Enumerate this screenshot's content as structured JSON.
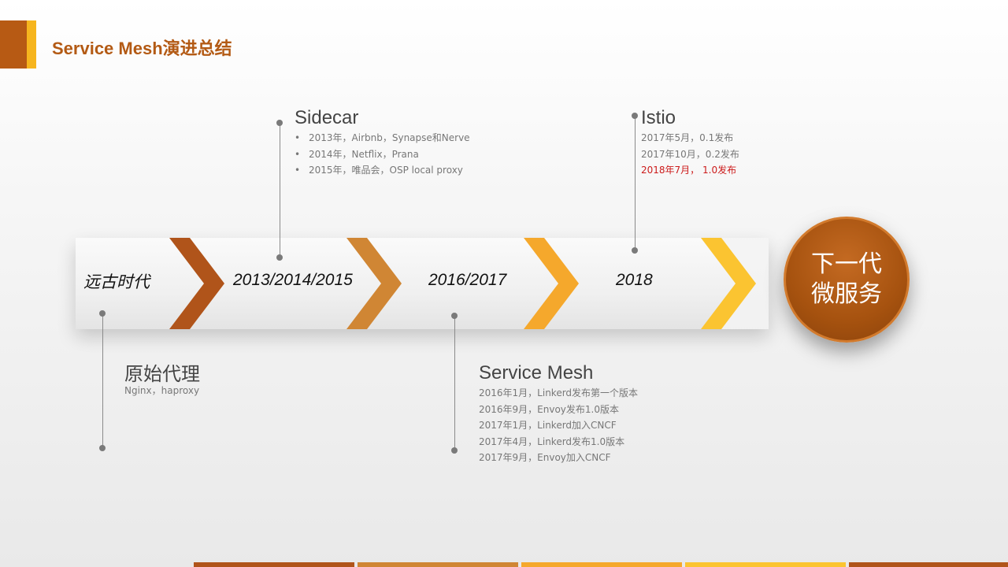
{
  "header": {
    "title": "Service Mesh演进总结"
  },
  "timeline": {
    "eras": [
      "远古时代",
      "2013/2014/2015",
      "2016/2017",
      "2018"
    ],
    "final_stage": {
      "line1": "下一代",
      "line2": "微服务"
    },
    "colors": {
      "chevron1": "#b0541a",
      "chevron2": "#d08634",
      "chevron3": "#f5a82c",
      "chevron4": "#fbc431",
      "accent": "#b35a14",
      "highlight": "#cc1b1b"
    }
  },
  "annotations": {
    "sidecar": {
      "title": "Sidecar",
      "items": [
        "2013年，Airbnb，Synapse和Nerve",
        "2014年，Netflix，Prana",
        "2015年，唯品会，OSP  local proxy"
      ]
    },
    "istio": {
      "title": "Istio",
      "items": [
        "2017年5月，0.1发布",
        "2017年10月，0.2发布",
        "2018年7月，  1.0发布"
      ]
    },
    "primitive": {
      "title": "原始代理",
      "items": [
        "Nginx，haproxy"
      ]
    },
    "service_mesh": {
      "title": "Service Mesh",
      "items": [
        "2016年1月，Linkerd发布第一个版本",
        "2016年9月，Envoy发布1.0版本",
        "2017年1月，Linkerd加入CNCF",
        "2017年4月，Linkerd发布1.0版本",
        "2017年9月，Envoy加入CNCF"
      ]
    }
  }
}
